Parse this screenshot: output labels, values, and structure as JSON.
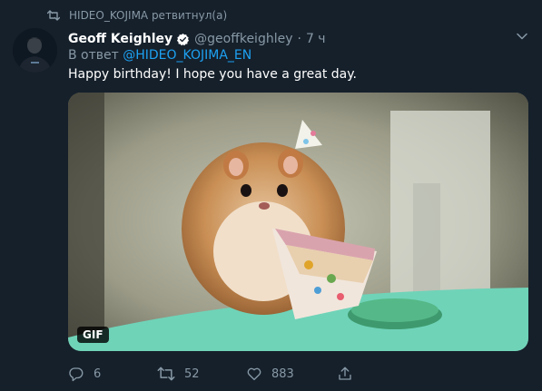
{
  "retweet_notice": {
    "icon": "retweet-icon",
    "text": "HIDEO_KOJIMA ретвитнул(а)"
  },
  "tweet": {
    "author_name": "Geoff Keighley",
    "verified": true,
    "handle": "@geoffkeighley",
    "separator": "·",
    "time": "7 ч",
    "reply_prefix": "В ответ",
    "reply_to": "@HIDEO_KOJIMA_EN",
    "text": "Happy birthday! I hope you have a great day.",
    "media": {
      "type": "gif",
      "badge": "GIF"
    }
  },
  "actions": {
    "reply": {
      "icon": "reply-icon",
      "count": "6"
    },
    "retweet": {
      "icon": "retweet-icon",
      "count": "52"
    },
    "like": {
      "icon": "heart-icon",
      "count": "883"
    },
    "share": {
      "icon": "share-icon"
    }
  },
  "colors": {
    "background": "#15202b",
    "text": "#ffffff",
    "muted": "#8899a6",
    "accent": "#1da1f2"
  }
}
